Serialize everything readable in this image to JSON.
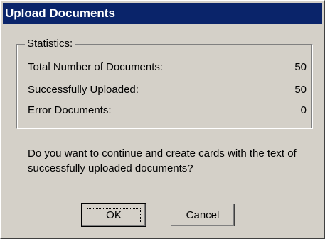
{
  "window": {
    "title": "Upload Documents"
  },
  "statistics": {
    "group_label": "Statistics:",
    "rows": [
      {
        "label": "Total Number of Documents:",
        "value": "50"
      },
      {
        "label": "Successfully Uploaded:",
        "value": "50"
      },
      {
        "label": "Error Documents:",
        "value": "0"
      }
    ]
  },
  "message": "Do you want to continue and create cards with the text of successfully uploaded documents?",
  "buttons": {
    "ok_label": "OK",
    "cancel_label": "Cancel"
  },
  "colors": {
    "titlebar": "#0a246a",
    "face": "#d4d0c8"
  }
}
